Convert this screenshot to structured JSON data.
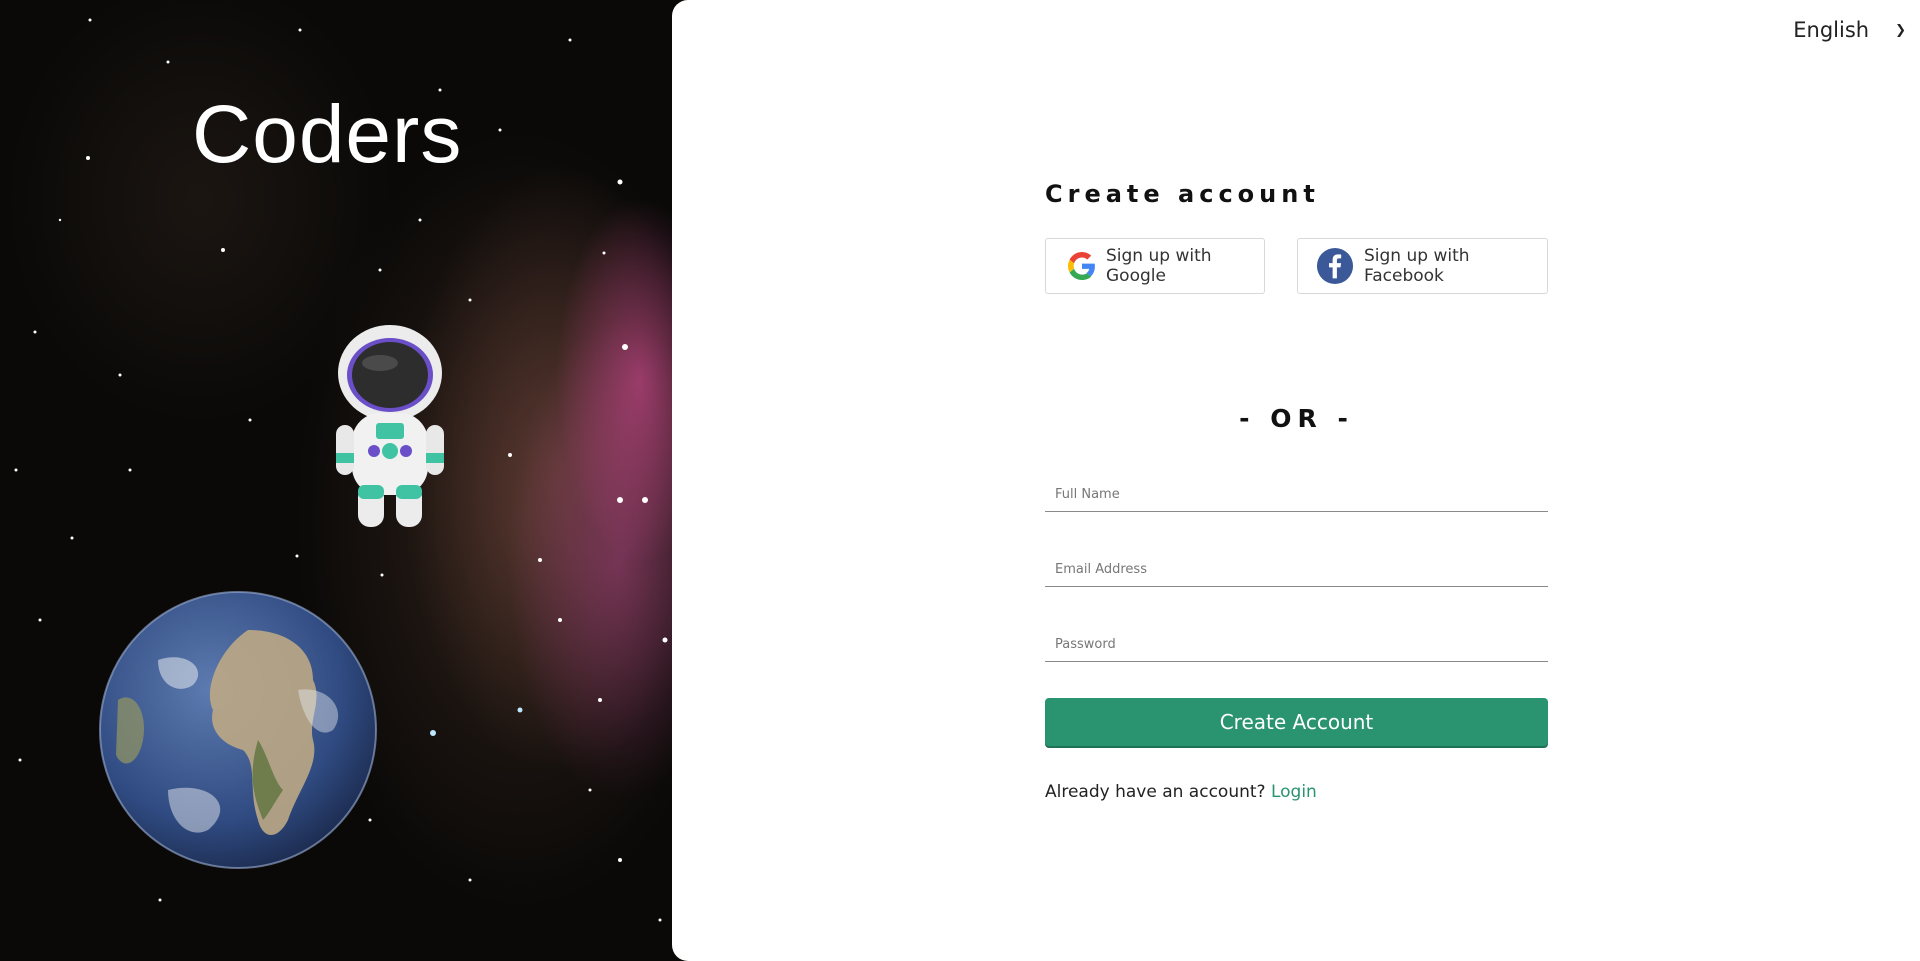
{
  "brand": {
    "name": "Coders"
  },
  "language": {
    "selected": "English"
  },
  "signup": {
    "title": "Create account",
    "google_label": "Sign up with Google",
    "facebook_label": "Sign up with Facebook",
    "divider": "- OR -",
    "full_name_placeholder": "Full Name",
    "email_placeholder": "Email Address",
    "password_placeholder": "Password",
    "create_label": "Create Account",
    "login_prompt": "Already have an account?",
    "login_link": "Login"
  },
  "colors": {
    "accent": "#2a9470",
    "facebook": "#3b5998",
    "panel": "#ffffff"
  },
  "icons": [
    "google-icon",
    "facebook-icon",
    "chevron-down-icon"
  ]
}
